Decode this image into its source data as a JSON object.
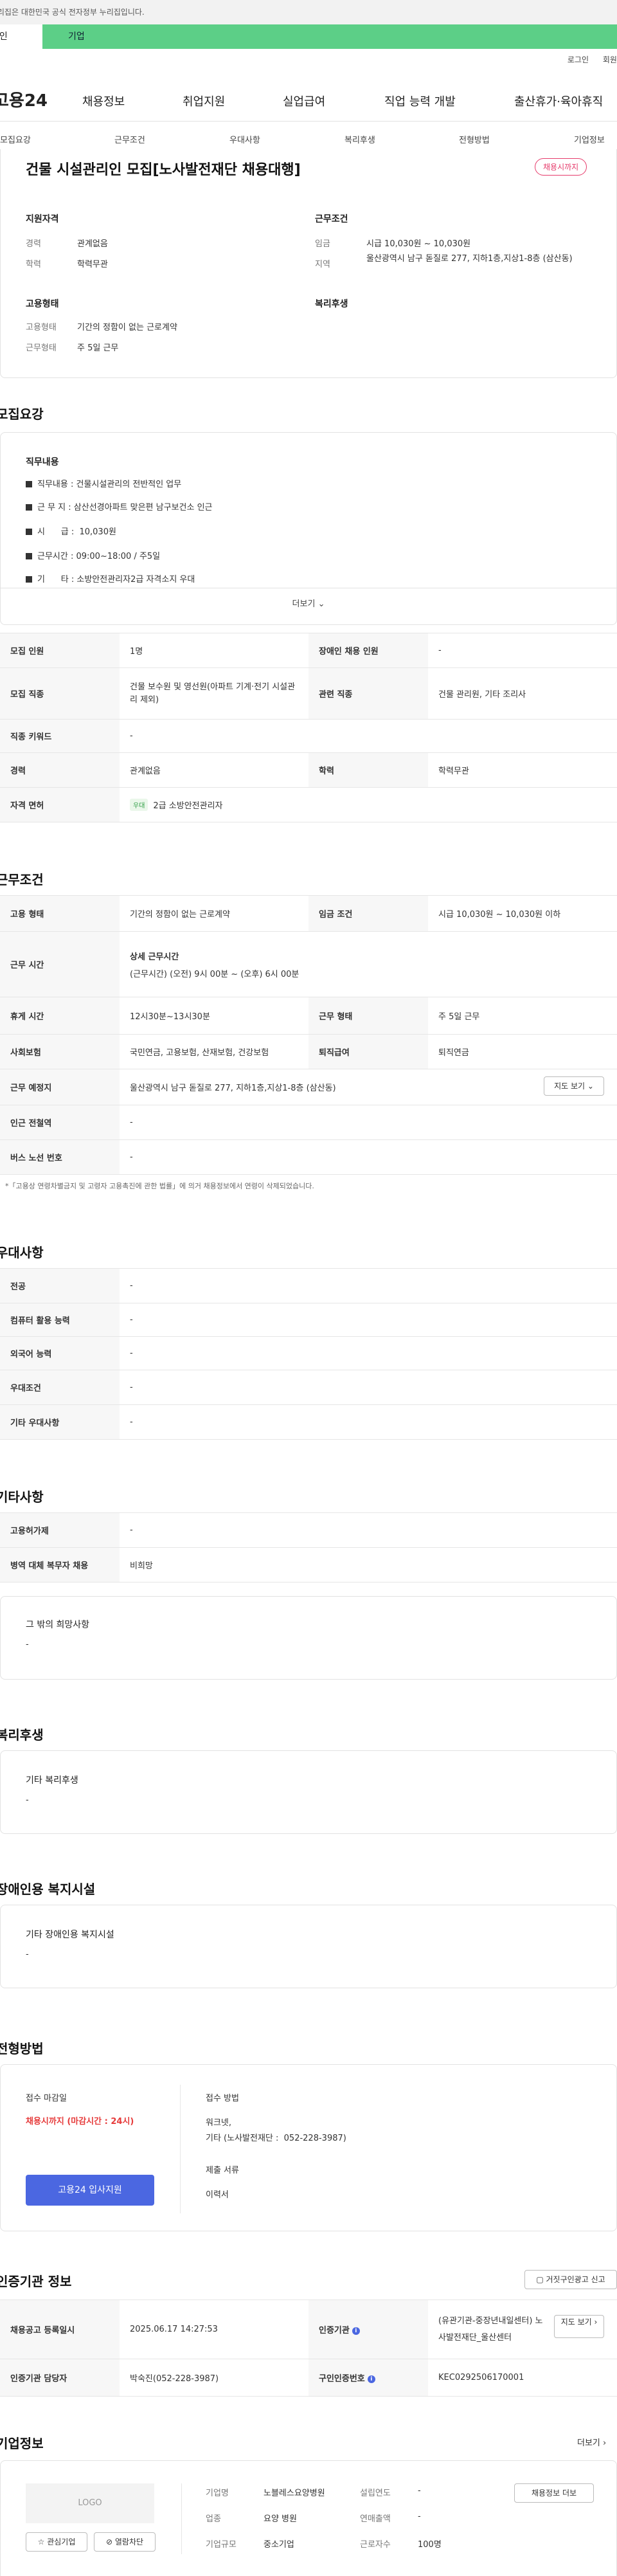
{
  "gov_bar": {
    "text": "이 누리집은 대한민국 공식 전자정부 누리집입니다."
  },
  "user_tabs": {
    "person": "개인",
    "company": "기업"
  },
  "util": {
    "login": "로그인",
    "signup": "회원가입"
  },
  "brand": {
    "logo": "고용24"
  },
  "gnb": [
    "채용정보",
    "취업지원",
    "실업급여",
    "직업 능력 개발",
    "출산휴가·육아휴직"
  ],
  "anchor_nav": [
    "모집요강",
    "근무조건",
    "우대사항",
    "복리후생",
    "전형방법",
    "기업정보"
  ],
  "summary": {
    "title": "건물 시설관리인 모집[노사발전재단 채용대행]",
    "deadline_badge": "채용시까지",
    "qualification": {
      "heading": "지원자격",
      "rows": [
        {
          "k": "경력",
          "v": "관계없음"
        },
        {
          "k": "학력",
          "v": "학력무관"
        }
      ]
    },
    "conditions": {
      "heading": "근무조건",
      "rows": [
        {
          "k": "임금",
          "v": "시급 10,030원 ~ 10,030원"
        },
        {
          "k": "지역",
          "v": "울산광역시 남구 돋질로 277, 지하1층,지상1-8층 (삼산동)"
        }
      ]
    },
    "employment": {
      "heading": "고용형태",
      "rows": [
        {
          "k": "고용형태",
          "v": "기간의 정함이 없는 근로계약"
        },
        {
          "k": "근무형태",
          "v": "주 5일 근무"
        }
      ]
    },
    "welfare": {
      "heading": "복리후생"
    }
  },
  "recruit": {
    "section_title": "모집요강",
    "duty_heading": "직무내용",
    "duty_lines": [
      "직무내용 : 건물시설관리의 전반적인 업무",
      "근 무 지 :  삼산선경아파트 맞은편 남구보건소 인근",
      "시      급 :  10,030원",
      "근무시간 : 09:00~18:00 / 주5일",
      "기      타 : 소방안전관리자2급 자격소지 우대"
    ],
    "more_label": "더보기",
    "table": [
      [
        {
          "k": "모집 인원",
          "v": "1명"
        },
        {
          "k": "장애인 채용 인원",
          "v": "-"
        }
      ],
      [
        {
          "k": "모집 직종",
          "v": "건물 보수원 및 영선원(아파트 기계·전기 시설관리 제외)"
        },
        {
          "k": "관련 직종",
          "v": "건물 관리원, 기타 조리사"
        }
      ],
      [
        {
          "k": "직종 키워드",
          "v": "-"
        }
      ],
      [
        {
          "k": "경력",
          "v": "관계없음"
        },
        {
          "k": "학력",
          "v": "학력무관"
        }
      ],
      [
        {
          "k": "자격 면허",
          "v": "2급 소방안전관리자",
          "chip": "우대"
        }
      ]
    ]
  },
  "work": {
    "section_title": "근무조건",
    "rows": [
      [
        {
          "k": "고용 형태",
          "v": "기간의 정함이 없는 근로계약"
        },
        {
          "k": "임금 조건",
          "v": "시급 10,030원 ~ 10,030원 이하"
        }
      ],
      [
        {
          "k": "근무 시간",
          "v_title": "상세 근무시간",
          "v": "(근무시간) (오전) 9시 00분 ~ (오후) 6시 00분"
        }
      ],
      [
        {
          "k": "휴게 시간",
          "v": "12시30분~13시30분"
        },
        {
          "k": "근무 형태",
          "v": "주 5일 근무"
        }
      ],
      [
        {
          "k": "사회보험",
          "v": "국민연금, 고용보험, 산재보험, 건강보험"
        },
        {
          "k": "퇴직급여",
          "v": "퇴직연금"
        }
      ],
      [
        {
          "k": "근무 예정지",
          "v": "울산광역시 남구 돋질로 277, 지하1층,지상1-8층 (삼산동)"
        }
      ],
      [
        {
          "k": "인근 전철역",
          "v": "-"
        }
      ],
      [
        {
          "k": "버스 노선 번호",
          "v": "-"
        }
      ]
    ],
    "map_button": "지도 보기",
    "note": "*「고용상 연령차별금지 및 고령자 고용촉진에 관한 법률」에 의거 채용정보에서 연령이 삭제되었습니다."
  },
  "pref": {
    "section_title": "우대사항",
    "rows": [
      {
        "k": "전공",
        "v": "-"
      },
      {
        "k": "컴퓨터 활용 능력",
        "v": "-"
      },
      {
        "k": "외국어 능력",
        "v": "-"
      },
      {
        "k": "우대조건",
        "v": "-"
      },
      {
        "k": "기타 우대사항",
        "v": "-"
      }
    ]
  },
  "etc": {
    "section_title": "기타사항",
    "rows": [
      {
        "k": "고용허가제",
        "v": "-"
      },
      {
        "k": "병역 대체 복무자 채용",
        "v": "비희망"
      }
    ],
    "box_title": "그 밖의 희망사항",
    "box_value": "-"
  },
  "welfare": {
    "section_title": "복리후생",
    "box_title": "기타 복리후생",
    "box_value": "-"
  },
  "disability": {
    "section_title": "장애인용 복지시설",
    "box_title": "기타 장애인용 복지시설",
    "box_value": "-"
  },
  "selection": {
    "section_title": "전형방법",
    "deadline_label": "접수 마감일",
    "deadline_value": "채용시까지 (마감시간 : 24시)",
    "apply_button": "고용24 입사지원",
    "method_label": "접수 방법",
    "method_value1": "워크넷,",
    "method_value2": "기타 (노사발전재단 :  052-228-3987)",
    "docs_label": "제출 서류",
    "docs_value": "이력서"
  },
  "auth": {
    "section_title": "인증기관 정보",
    "report_button": "거짓구인광고 신고",
    "rows": [
      [
        {
          "k": "채용공고 등록일시",
          "v": "2025.06.17 14:27:53"
        },
        {
          "k": "인증기관",
          "v": "(유관기관-중장년내일센터) 노사발전재단_울산센터",
          "info": "i"
        }
      ],
      [
        {
          "k": "인증기관 담당자",
          "v": "박숙진(052-228-3987)"
        },
        {
          "k": "구인인증번호",
          "v": "KEC0292506170001",
          "info": "i"
        }
      ]
    ],
    "map_button": "지도 보기"
  },
  "company": {
    "section_title": "기업정보",
    "more_label": "더보기",
    "logo_text": "LOGO",
    "fav_button": "관심기업",
    "block_button": "열람차단",
    "rows": [
      [
        {
          "k": "기업명",
          "v": "노블레스요양병원"
        },
        {
          "k": "설립연도",
          "v": "-"
        }
      ],
      [
        {
          "k": "업종",
          "v": "요양 병원"
        },
        {
          "k": "연매출액",
          "v": "-"
        }
      ],
      [
        {
          "k": "기업규모",
          "v": "중소기업"
        },
        {
          "k": "근로자수",
          "v": "100명"
        }
      ]
    ],
    "other_jobs_button": "채용정보 더보"
  },
  "colors": {
    "brand_green": "#5ccf87",
    "accent_blue": "#4b67e1",
    "deadline_red": "#e63b6b"
  },
  "icons": {
    "chevron": "chevron-down-icon",
    "star": "star-icon",
    "block": "block-icon",
    "info": "info-icon",
    "document": "document-icon"
  }
}
